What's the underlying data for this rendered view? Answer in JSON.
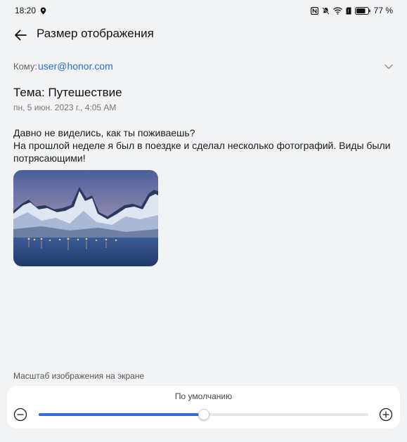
{
  "status_bar": {
    "time": "18:20",
    "battery": "77 %",
    "icons": [
      "location-icon",
      "nfc-icon",
      "mute-icon",
      "wifi-icon",
      "sim-icon",
      "battery-icon"
    ]
  },
  "header": {
    "title": "Размер отображения",
    "back_icon": "back-arrow-icon"
  },
  "email": {
    "to_label": "Кому:",
    "to_value": "user@honor.com",
    "subject": "Тема: Путешествие",
    "date": "пн, 5 июн. 2023 г., 4:05 AM",
    "body": [
      "Давно не виделись, как ты поживаешь?",
      "На прошлой неделе я был в поездке и сделал несколько фотографий. Виды были потрясающими!"
    ],
    "image_icon": "mountain-lake-photo"
  },
  "scale": {
    "label": "Масштаб изображения на экране",
    "value": "По умолчанию",
    "level": 0.5,
    "accent": "#2f6ee0"
  }
}
